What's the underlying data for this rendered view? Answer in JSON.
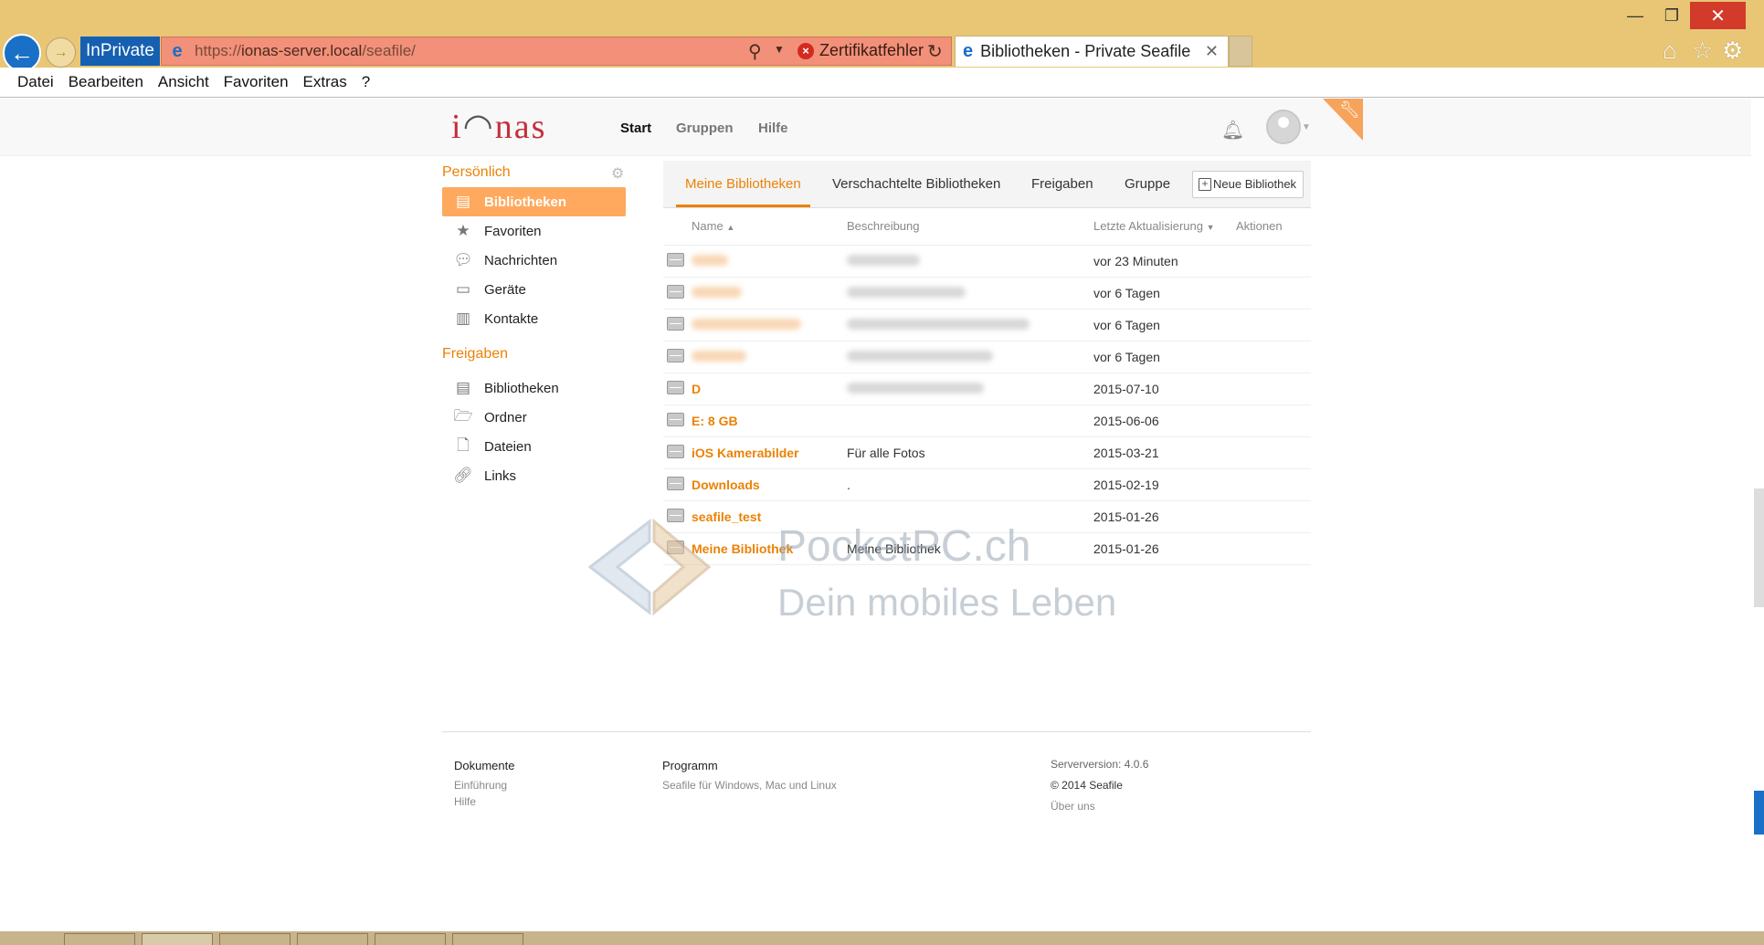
{
  "browser": {
    "inprivate_label": "InPrivate",
    "url_prefix": "https://",
    "url_domain": "ionas-server.local",
    "url_path": "/seafile/",
    "cert_error_label": "Zertifikatfehler",
    "tab_title": "Bibliotheken - Private Seafile",
    "window_controls": {
      "minimize": "—",
      "maximize": "❐",
      "close": "✕"
    }
  },
  "menubar": [
    "Datei",
    "Bearbeiten",
    "Ansicht",
    "Favoriten",
    "Extras",
    "?"
  ],
  "header": {
    "nav": [
      "Start",
      "Gruppen",
      "Hilfe"
    ]
  },
  "sidebar": {
    "personal_heading": "Persönlich",
    "personal_items": [
      {
        "label": "Bibliotheken",
        "icon": "library-icon",
        "active": true
      },
      {
        "label": "Favoriten",
        "icon": "star-icon"
      },
      {
        "label": "Nachrichten",
        "icon": "messages-icon"
      },
      {
        "label": "Geräte",
        "icon": "devices-icon"
      },
      {
        "label": "Kontakte",
        "icon": "contacts-icon"
      }
    ],
    "shares_heading": "Freigaben",
    "shares_items": [
      {
        "label": "Bibliotheken",
        "icon": "library-icon"
      },
      {
        "label": "Ordner",
        "icon": "folder-icon"
      },
      {
        "label": "Dateien",
        "icon": "file-icon"
      },
      {
        "label": "Links",
        "icon": "link-icon"
      }
    ]
  },
  "tabs": {
    "mine": "Meine Bibliotheken",
    "sub": "Verschachtelte Bibliotheken",
    "shares": "Freigaben",
    "group": "Gruppe",
    "new_library": "Neue Bibliothek"
  },
  "table": {
    "headers": {
      "name": "Name",
      "description": "Beschreibung",
      "updated": "Letzte Aktualisierung",
      "actions": "Aktionen"
    },
    "rows": [
      {
        "name": "",
        "description": "",
        "updated": "vor 23 Minuten",
        "blur_name": 40,
        "blur_desc": 80
      },
      {
        "name": "",
        "description": "",
        "updated": "vor 6 Tagen",
        "blur_name": 55,
        "blur_desc": 130
      },
      {
        "name": "",
        "description": "",
        "updated": "vor 6 Tagen",
        "blur_name": 120,
        "blur_desc": 200
      },
      {
        "name": "",
        "description": "",
        "updated": "vor 6 Tagen",
        "blur_name": 60,
        "blur_desc": 160
      },
      {
        "name": "D",
        "description": "",
        "updated": "2015-07-10",
        "blur_name": 0,
        "blur_desc": 150
      },
      {
        "name": "E: 8 GB",
        "description": "",
        "updated": "2015-06-06",
        "blur_name": 0,
        "blur_desc": 0
      },
      {
        "name": "iOS Kamerabilder",
        "description": "Für alle Fotos",
        "updated": "2015-03-21",
        "blur_name": 0,
        "blur_desc": 0
      },
      {
        "name": "Downloads",
        "description": ".",
        "updated": "2015-02-19",
        "blur_name": 0,
        "blur_desc": 0
      },
      {
        "name": "seafile_test",
        "description": "",
        "updated": "2015-01-26",
        "blur_name": 0,
        "blur_desc": 0
      },
      {
        "name": "Meine Bibliothek",
        "description": "Meine Bibliothek",
        "updated": "2015-01-26",
        "blur_name": 0,
        "blur_desc": 0
      }
    ]
  },
  "watermark": {
    "brand": "PocketPC.ch",
    "slogan": "Dein mobiles Leben"
  },
  "footer": {
    "docs_heading": "Dokumente",
    "docs_links": [
      "Einführung",
      "Hilfe"
    ],
    "program_heading": "Programm",
    "program_link": "Seafile für Windows, Mac und Linux",
    "server_version": "Serverversion: 4.0.6",
    "copyright": "© 2014 Seafile",
    "about": "Über uns"
  },
  "colors": {
    "accent": "#eb8205",
    "active_item": "#fea95e",
    "chrome": "#e8c676",
    "address_error": "#f29079"
  }
}
